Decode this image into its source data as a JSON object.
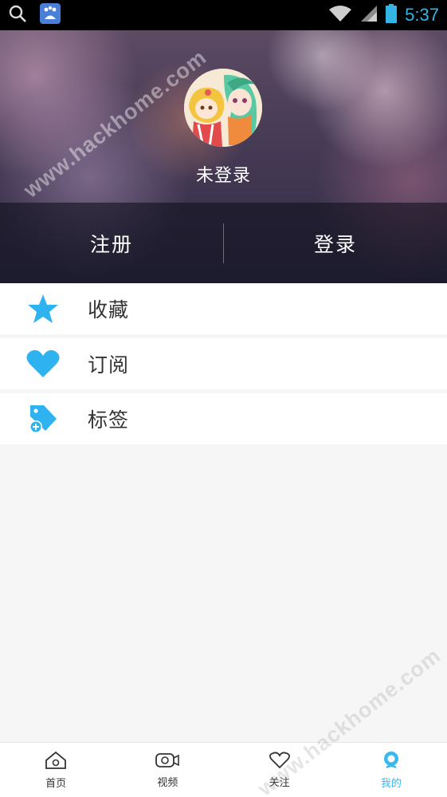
{
  "status_bar": {
    "time": "5:37",
    "icons": [
      "search-icon",
      "baidu-app-icon",
      "wifi-icon",
      "signal-icon",
      "battery-icon"
    ]
  },
  "profile": {
    "login_status": "未登录",
    "register_label": "注册",
    "login_label": "登录"
  },
  "menu": {
    "items": [
      {
        "label": "收藏",
        "icon": "star-icon"
      },
      {
        "label": "订阅",
        "icon": "heart-icon"
      },
      {
        "label": "标签",
        "icon": "tag-icon"
      }
    ]
  },
  "bottom_nav": {
    "items": [
      {
        "label": "首页",
        "icon": "home-icon"
      },
      {
        "label": "视频",
        "icon": "video-icon"
      },
      {
        "label": "关注",
        "icon": "heart-outline-icon"
      },
      {
        "label": "我的",
        "icon": "profile-icon",
        "active": true
      }
    ]
  },
  "colors": {
    "accent": "#39b9ef",
    "icon_blue": "#2fb3f0",
    "clock": "#33b5e5"
  },
  "watermark": "www.hackhome.com"
}
